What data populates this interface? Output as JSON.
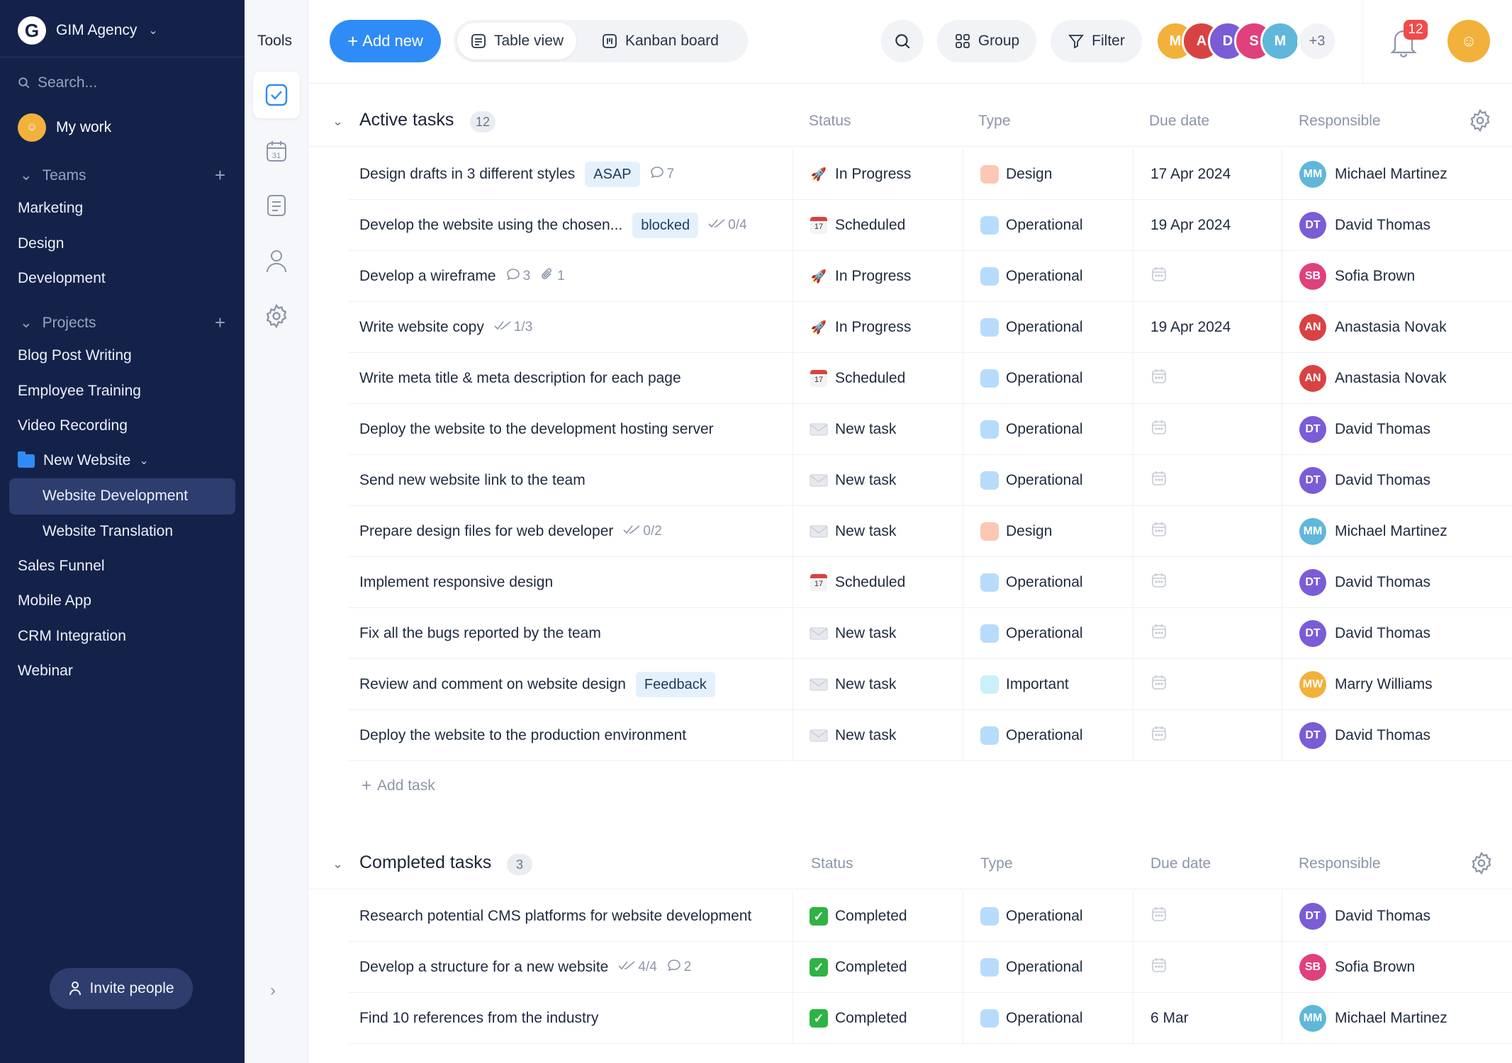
{
  "app": {
    "workspace": "GIM Agency",
    "logo_letter": "G"
  },
  "sidebar": {
    "search_placeholder": "Search...",
    "my_work": "My work",
    "teams_label": "Teams",
    "teams": [
      "Marketing",
      "Design",
      "Development"
    ],
    "projects_label": "Projects",
    "projects": [
      "Blog Post Writing",
      "Employee Training",
      "Video Recording"
    ],
    "folder": "New Website",
    "folder_items": [
      "Website Development",
      "Website Translation"
    ],
    "projects_more": [
      "Sales Funnel",
      "Mobile App",
      "CRM Integration",
      "Webinar"
    ],
    "invite": "Invite people"
  },
  "tools": {
    "title": "Tools",
    "icons": [
      "tasks-icon",
      "calendar-icon",
      "notes-icon",
      "people-icon",
      "settings-icon"
    ],
    "calendar_day": "31"
  },
  "toolbar": {
    "add_new": "Add new",
    "table_view": "Table view",
    "kanban_board": "Kanban board",
    "group": "Group",
    "filter": "Filter",
    "more_members": "+3",
    "notifications": "12"
  },
  "columns": {
    "status": "Status",
    "type": "Type",
    "due": "Due date",
    "responsible": "Responsible"
  },
  "active": {
    "title": "Active tasks",
    "count": "12",
    "add_task": "Add task",
    "tasks": [
      {
        "name": "Design drafts in 3 different styles",
        "tag": "ASAP",
        "meta": [
          {
            "icon": "comment-icon",
            "text": "7"
          }
        ],
        "status": "In Progress",
        "type": "Design",
        "due": "17 Apr 2024",
        "person": "Michael Martinez"
      },
      {
        "name": "Develop the website using the chosen...",
        "tag": "blocked",
        "meta": [
          {
            "icon": "checklist-icon",
            "text": "0/4"
          }
        ],
        "status": "Scheduled",
        "type": "Operational",
        "due": "19 Apr 2024",
        "person": "David Thomas"
      },
      {
        "name": "Develop a wireframe",
        "tag": "",
        "meta": [
          {
            "icon": "comment-icon",
            "text": "3"
          },
          {
            "icon": "attachment-icon",
            "text": "1"
          }
        ],
        "status": "In Progress",
        "type": "Operational",
        "due": "",
        "person": "Sofia Brown"
      },
      {
        "name": "Write website copy",
        "tag": "",
        "meta": [
          {
            "icon": "checklist-icon",
            "text": "1/3"
          }
        ],
        "status": "In Progress",
        "type": "Operational",
        "due": "19 Apr 2024",
        "person": "Anastasia Novak"
      },
      {
        "name": "Write meta title & meta description for each page",
        "tag": "",
        "meta": [],
        "status": "Scheduled",
        "type": "Operational",
        "due": "",
        "person": "Anastasia Novak"
      },
      {
        "name": "Deploy the website to the development hosting server",
        "tag": "",
        "meta": [],
        "status": "New task",
        "type": "Operational",
        "due": "",
        "person": "David Thomas"
      },
      {
        "name": "Send new website link to the team",
        "tag": "",
        "meta": [],
        "status": "New task",
        "type": "Operational",
        "due": "",
        "person": "David Thomas"
      },
      {
        "name": "Prepare design files for web developer",
        "tag": "",
        "meta": [
          {
            "icon": "checklist-icon",
            "text": "0/2"
          }
        ],
        "status": "New task",
        "type": "Design",
        "due": "",
        "person": "Michael Martinez"
      },
      {
        "name": "Implement responsive design",
        "tag": "",
        "meta": [],
        "status": "Scheduled",
        "type": "Operational",
        "due": "",
        "person": "David Thomas"
      },
      {
        "name": "Fix all the bugs reported by the team",
        "tag": "",
        "meta": [],
        "status": "New task",
        "type": "Operational",
        "due": "",
        "person": "David Thomas"
      },
      {
        "name": "Review and comment on website design",
        "tag": "Feedback",
        "meta": [],
        "status": "New task",
        "type": "Important",
        "due": "",
        "person": "Marry Williams"
      },
      {
        "name": "Deploy the website to the production environment",
        "tag": "",
        "meta": [],
        "status": "New task",
        "type": "Operational",
        "due": "",
        "person": "David Thomas"
      }
    ]
  },
  "completed": {
    "title": "Completed tasks",
    "count": "3",
    "tasks": [
      {
        "name": "Research potential CMS platforms for website development",
        "tag": "",
        "meta": [],
        "status": "Completed",
        "type": "Operational",
        "due": "",
        "person": "David Thomas"
      },
      {
        "name": "Develop a structure for a new website",
        "tag": "",
        "meta": [
          {
            "icon": "checklist-icon",
            "text": "4/4"
          },
          {
            "icon": "comment-icon",
            "text": "2"
          }
        ],
        "status": "Completed",
        "type": "Operational",
        "due": "",
        "person": "Sofia Brown"
      },
      {
        "name": "Find 10 references from the industry",
        "tag": "",
        "meta": [],
        "status": "Completed",
        "type": "Operational",
        "due": "6 Mar",
        "person": "Michael Martinez"
      }
    ]
  },
  "colors": {
    "accent": "#2f8cf6",
    "sidebar": "#14224a",
    "type": {
      "Design": "#fcc7b5",
      "Operational": "#b7dcfb",
      "Important": "#c9f0fb"
    },
    "people": {
      "Michael Martinez": "#5fb7d9",
      "David Thomas": "#7a5cd6",
      "Sofia Brown": "#e0407c",
      "Anastasia Novak": "#d94242",
      "Marry Williams": "#f2b13b"
    }
  }
}
